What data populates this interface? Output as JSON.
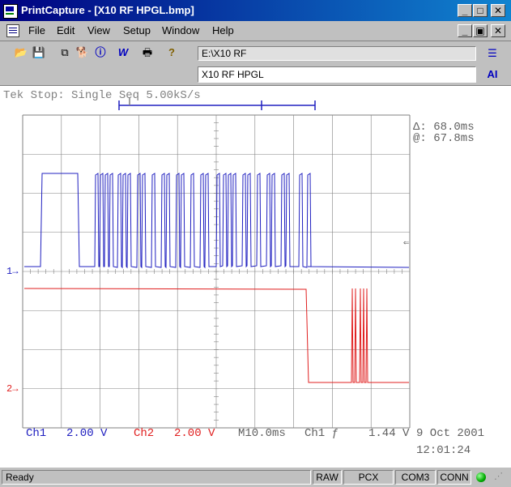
{
  "window": {
    "title": "PrintCapture - [X10 RF HPGL.bmp]"
  },
  "menu": {
    "items": [
      "File",
      "Edit",
      "View",
      "Setup",
      "Window",
      "Help"
    ]
  },
  "toolbar": {
    "path": "E:\\X10 RF",
    "filename": "X10 RF HPGL",
    "list_icon_label": "☰",
    "ai_label": "AI"
  },
  "scope": {
    "status_line": "Tek Stop: Single Seq  5.00kS/s",
    "delta": "Δ: 68.0ms",
    "at": "@: 67.8ms",
    "ch1_marker": "1→",
    "ch2_marker": "2→",
    "readout": {
      "ch1_label": "Ch1",
      "ch1_scale": "2.00 V",
      "ch2_label": "Ch2",
      "ch2_scale": "2.00 V",
      "timebase": "M10.0ms",
      "trigger": "Ch1 ƒ",
      "trigger_level": "1.44 V",
      "date": "9 Oct  2001",
      "time": "12:01:24"
    },
    "colors": {
      "ch1": "#2020c0",
      "ch2": "#e02020",
      "grid": "#808080"
    }
  },
  "status": {
    "ready": "Ready",
    "raw": "RAW",
    "pcx": "PCX",
    "port": "COM3",
    "conn": "CONN"
  }
}
